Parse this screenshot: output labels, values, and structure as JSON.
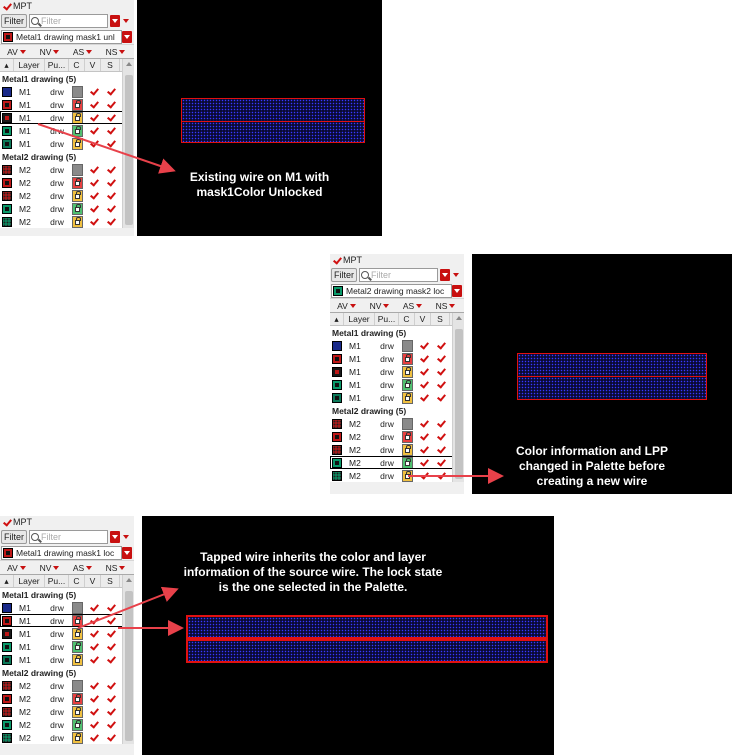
{
  "mpt_label": "MPT",
  "filter_button": "Filter",
  "filter_placeholder": "Filter",
  "visibility_row": [
    "AV",
    "NV",
    "AS",
    "NS"
  ],
  "table_columns": [
    "Layer",
    "Pu...",
    "C",
    "V",
    "S"
  ],
  "groups": {
    "metal1": "Metal1 drawing (5)",
    "metal2": "Metal2 drawing (5)"
  },
  "lpp_selections": {
    "panel1": "Metal1 drawing mask1 unl",
    "panel2": "Metal2 drawing mask2 loc",
    "panel3": "Metal1 drawing mask1 loc"
  },
  "rows": {
    "metal1": [
      {
        "layer": "M1",
        "purpose": "drw"
      },
      {
        "layer": "M1",
        "purpose": "drw"
      },
      {
        "layer": "M1",
        "purpose": "drw"
      },
      {
        "layer": "M1",
        "purpose": "drw"
      },
      {
        "layer": "M1",
        "purpose": "drw"
      }
    ],
    "metal2": [
      {
        "layer": "M2",
        "purpose": "drw"
      },
      {
        "layer": "M2",
        "purpose": "drw"
      },
      {
        "layer": "M2",
        "purpose": "drw"
      },
      {
        "layer": "M2",
        "purpose": "drw"
      },
      {
        "layer": "M2",
        "purpose": "drw"
      }
    ]
  },
  "annotations": {
    "one": [
      "Existing wire on M1 with",
      "mask1Color Unlocked"
    ],
    "two": [
      "Color information and LPP",
      "changed in Palette before",
      "creating a new wire"
    ],
    "three": [
      "Tapped wire inherits the color and layer",
      "information of the source wire. The lock state",
      "is the one selected in the Palette."
    ]
  },
  "colors": {
    "canvas": "#000000",
    "wire_outline": "#e11010",
    "wire_fill": "#0a0a33",
    "arrow": "#e8414a",
    "check": "#d01010"
  }
}
